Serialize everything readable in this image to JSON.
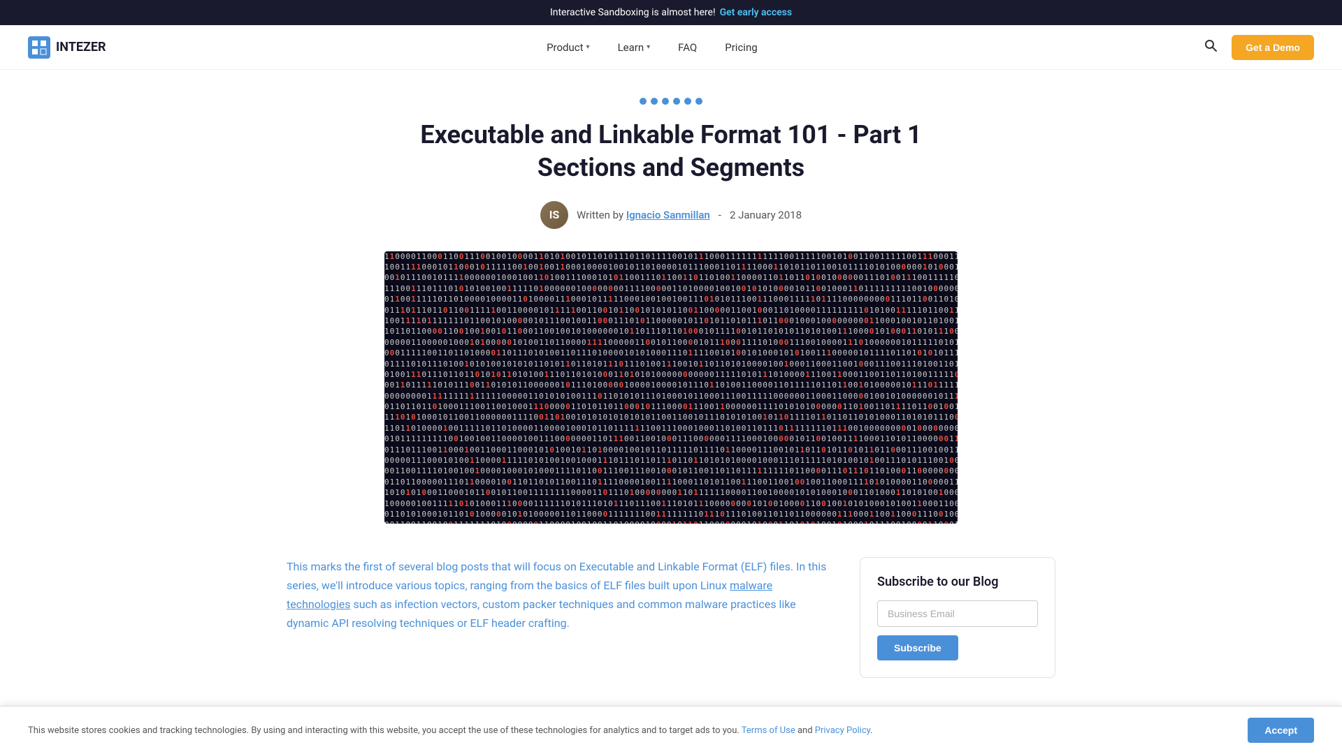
{
  "banner": {
    "text": "Interactive Sandboxing is almost here!",
    "cta_label": "Get early access",
    "cta_href": "#"
  },
  "nav": {
    "logo_text": "INTEZER",
    "product_label": "Product",
    "learn_label": "Learn",
    "faq_label": "FAQ",
    "pricing_label": "Pricing",
    "get_demo_label": "Get a Demo"
  },
  "article": {
    "category_dots": 6,
    "title": "Executable and Linkable Format 101 - Part 1 Sections and Segments",
    "author": "Ignacio Sanmillan",
    "written_by": "Written by",
    "date": "2 January 2018",
    "intro": "This marks the first of several blog posts that will focus on Executable and Linkable Format (ELF) files. In this series, we'll introduce various topics, ranging from the basics of ELF files built upon Linux malware technologies such as infection vectors, custom packer techniques and common malware practices like dynamic API resolving techniques or ELF header crafting."
  },
  "sidebar": {
    "subscribe_title": "Subscribe to our Blog",
    "email_placeholder": "Business Email",
    "subscribe_button": "Subscribe"
  },
  "cookie": {
    "text": "This website stores cookies and tracking technologies. By using and interacting with this website, you accept the use of these technologies for analytics and to target ads to you.",
    "terms_label": "Terms of Use",
    "privacy_label": "Privacy Policy",
    "accept_label": "Accept"
  },
  "colors": {
    "accent_blue": "#4a90d9",
    "accent_orange": "#f5a623",
    "dark": "#1a1a2e",
    "red": "#e74c3c"
  }
}
